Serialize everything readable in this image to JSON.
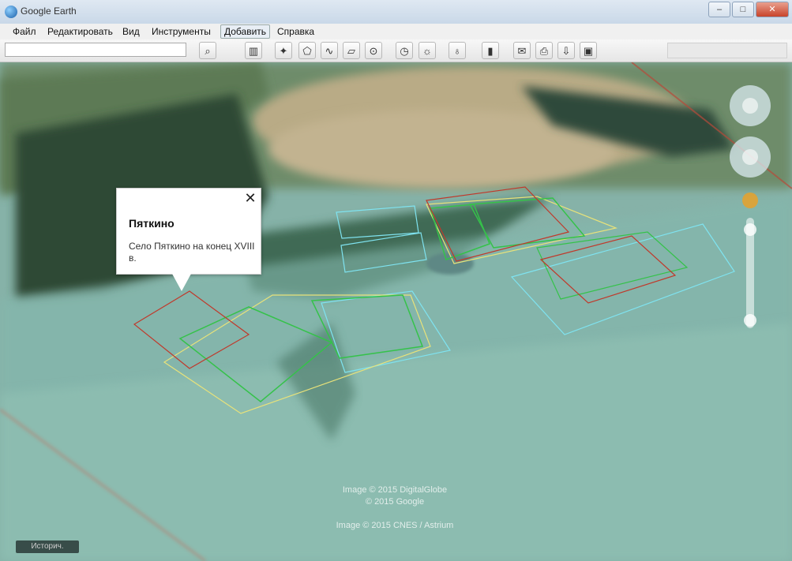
{
  "window": {
    "title": "Google Earth"
  },
  "menu": {
    "items": [
      "Файл",
      "Редактировать",
      "Вид",
      "Инструменты",
      "Добавить",
      "Справка"
    ],
    "active": "Добавить"
  },
  "toolbar": {
    "search_placeholder": "",
    "buttons": [
      "search-icon",
      "sidebar-icon",
      "placemark-icon",
      "polygon-icon",
      "path-icon",
      "image-overlay-icon",
      "tour-icon",
      "history-icon",
      "sun-icon",
      "planet-icon",
      "ruler-icon",
      "email-icon",
      "print-icon",
      "map-export-icon",
      "image-export-icon"
    ]
  },
  "popup": {
    "title": "Пяткино",
    "description": "Село Пяткино на конец XVIII в.",
    "close": "✕"
  },
  "credits": {
    "line1": "Image © 2015 DigitalGlobe",
    "line2": "© 2015 Google",
    "line3": "Image © 2015 CNES / Astrium"
  },
  "status": {
    "left": "Историч."
  },
  "colors": {
    "red": "#c0392b",
    "yellow": "#e8e27a",
    "green": "#35c24a",
    "cyan": "#7fe3f0"
  }
}
